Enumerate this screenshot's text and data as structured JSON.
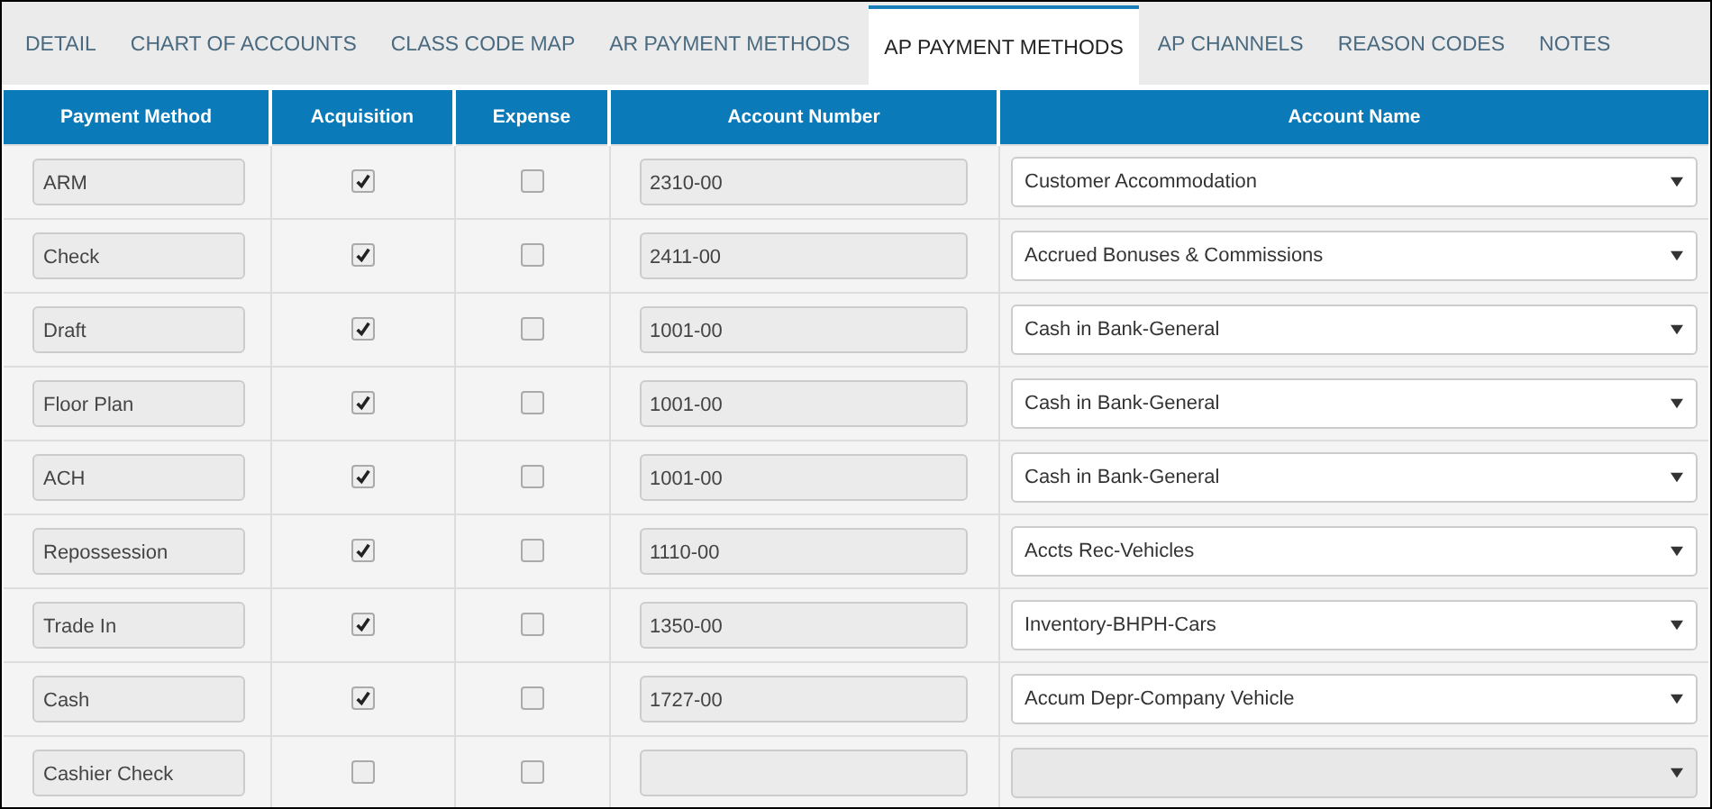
{
  "tabs": [
    {
      "label": "DETAIL",
      "selected": false
    },
    {
      "label": "CHART OF ACCOUNTS",
      "selected": false
    },
    {
      "label": "CLASS CODE MAP",
      "selected": false
    },
    {
      "label": "AR PAYMENT METHODS",
      "selected": false
    },
    {
      "label": "AP PAYMENT METHODS",
      "selected": true
    },
    {
      "label": "AP CHANNELS",
      "selected": false
    },
    {
      "label": "REASON CODES",
      "selected": false
    },
    {
      "label": "NOTES",
      "selected": false
    }
  ],
  "table": {
    "columns": [
      "Payment Method",
      "Acquisition",
      "Expense",
      "Account Number",
      "Account Name"
    ],
    "rows": [
      {
        "payment_method": "ARM",
        "acquisition": true,
        "expense": false,
        "account_number": "2310-00",
        "account_name": "Customer Accommodation"
      },
      {
        "payment_method": "Check",
        "acquisition": true,
        "expense": false,
        "account_number": "2411-00",
        "account_name": "Accrued Bonuses & Commissions"
      },
      {
        "payment_method": "Draft",
        "acquisition": true,
        "expense": false,
        "account_number": "1001-00",
        "account_name": "Cash in Bank-General"
      },
      {
        "payment_method": "Floor Plan",
        "acquisition": true,
        "expense": false,
        "account_number": "1001-00",
        "account_name": "Cash in Bank-General"
      },
      {
        "payment_method": "ACH",
        "acquisition": true,
        "expense": false,
        "account_number": "1001-00",
        "account_name": "Cash in Bank-General"
      },
      {
        "payment_method": "Repossession",
        "acquisition": true,
        "expense": false,
        "account_number": "1110-00",
        "account_name": "Accts Rec-Vehicles"
      },
      {
        "payment_method": "Trade In",
        "acquisition": true,
        "expense": false,
        "account_number": "1350-00",
        "account_name": "Inventory-BHPH-Cars"
      },
      {
        "payment_method": "Cash",
        "acquisition": true,
        "expense": false,
        "account_number": "1727-00",
        "account_name": "Accum Depr-Company Vehicle"
      },
      {
        "payment_method": "Cashier Check",
        "acquisition": false,
        "expense": false
      }
    ]
  }
}
